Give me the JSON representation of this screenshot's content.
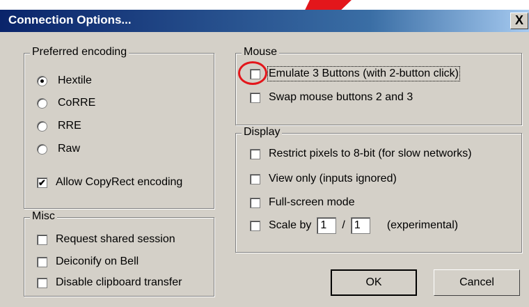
{
  "window": {
    "title": "Connection Options...",
    "close_glyph": "X"
  },
  "encoding": {
    "legend": "Preferred encoding",
    "options": [
      {
        "label": "Hextile",
        "selected": true
      },
      {
        "label": "CoRRE",
        "selected": false
      },
      {
        "label": "RRE",
        "selected": false
      },
      {
        "label": "Raw",
        "selected": false
      }
    ],
    "copyrect": {
      "label": "Allow CopyRect encoding",
      "checked": true
    }
  },
  "misc": {
    "legend": "Misc",
    "items": [
      {
        "label": "Request shared session",
        "checked": false
      },
      {
        "label": "Deiconify on Bell",
        "checked": false
      },
      {
        "label": "Disable clipboard transfer",
        "checked": false
      }
    ]
  },
  "mouse": {
    "legend": "Mouse",
    "items": [
      {
        "label": "Emulate 3 Buttons (with 2-button click)",
        "checked": false
      },
      {
        "label": "Swap mouse buttons 2 and 3",
        "checked": false
      }
    ]
  },
  "display": {
    "legend": "Display",
    "items": [
      {
        "label": "Restrict pixels to 8-bit (for slow networks)",
        "checked": false
      },
      {
        "label": "View only (inputs ignored)",
        "checked": false
      },
      {
        "label": "Full-screen mode",
        "checked": false
      }
    ],
    "scale": {
      "label": "Scale by",
      "numerator": "1",
      "separator": "/",
      "denominator": "1",
      "note": "(experimental)",
      "checked": false
    }
  },
  "buttons": {
    "ok": "OK",
    "cancel": "Cancel"
  },
  "annotation_color": "#e3161b",
  "check_glyph": "✔"
}
